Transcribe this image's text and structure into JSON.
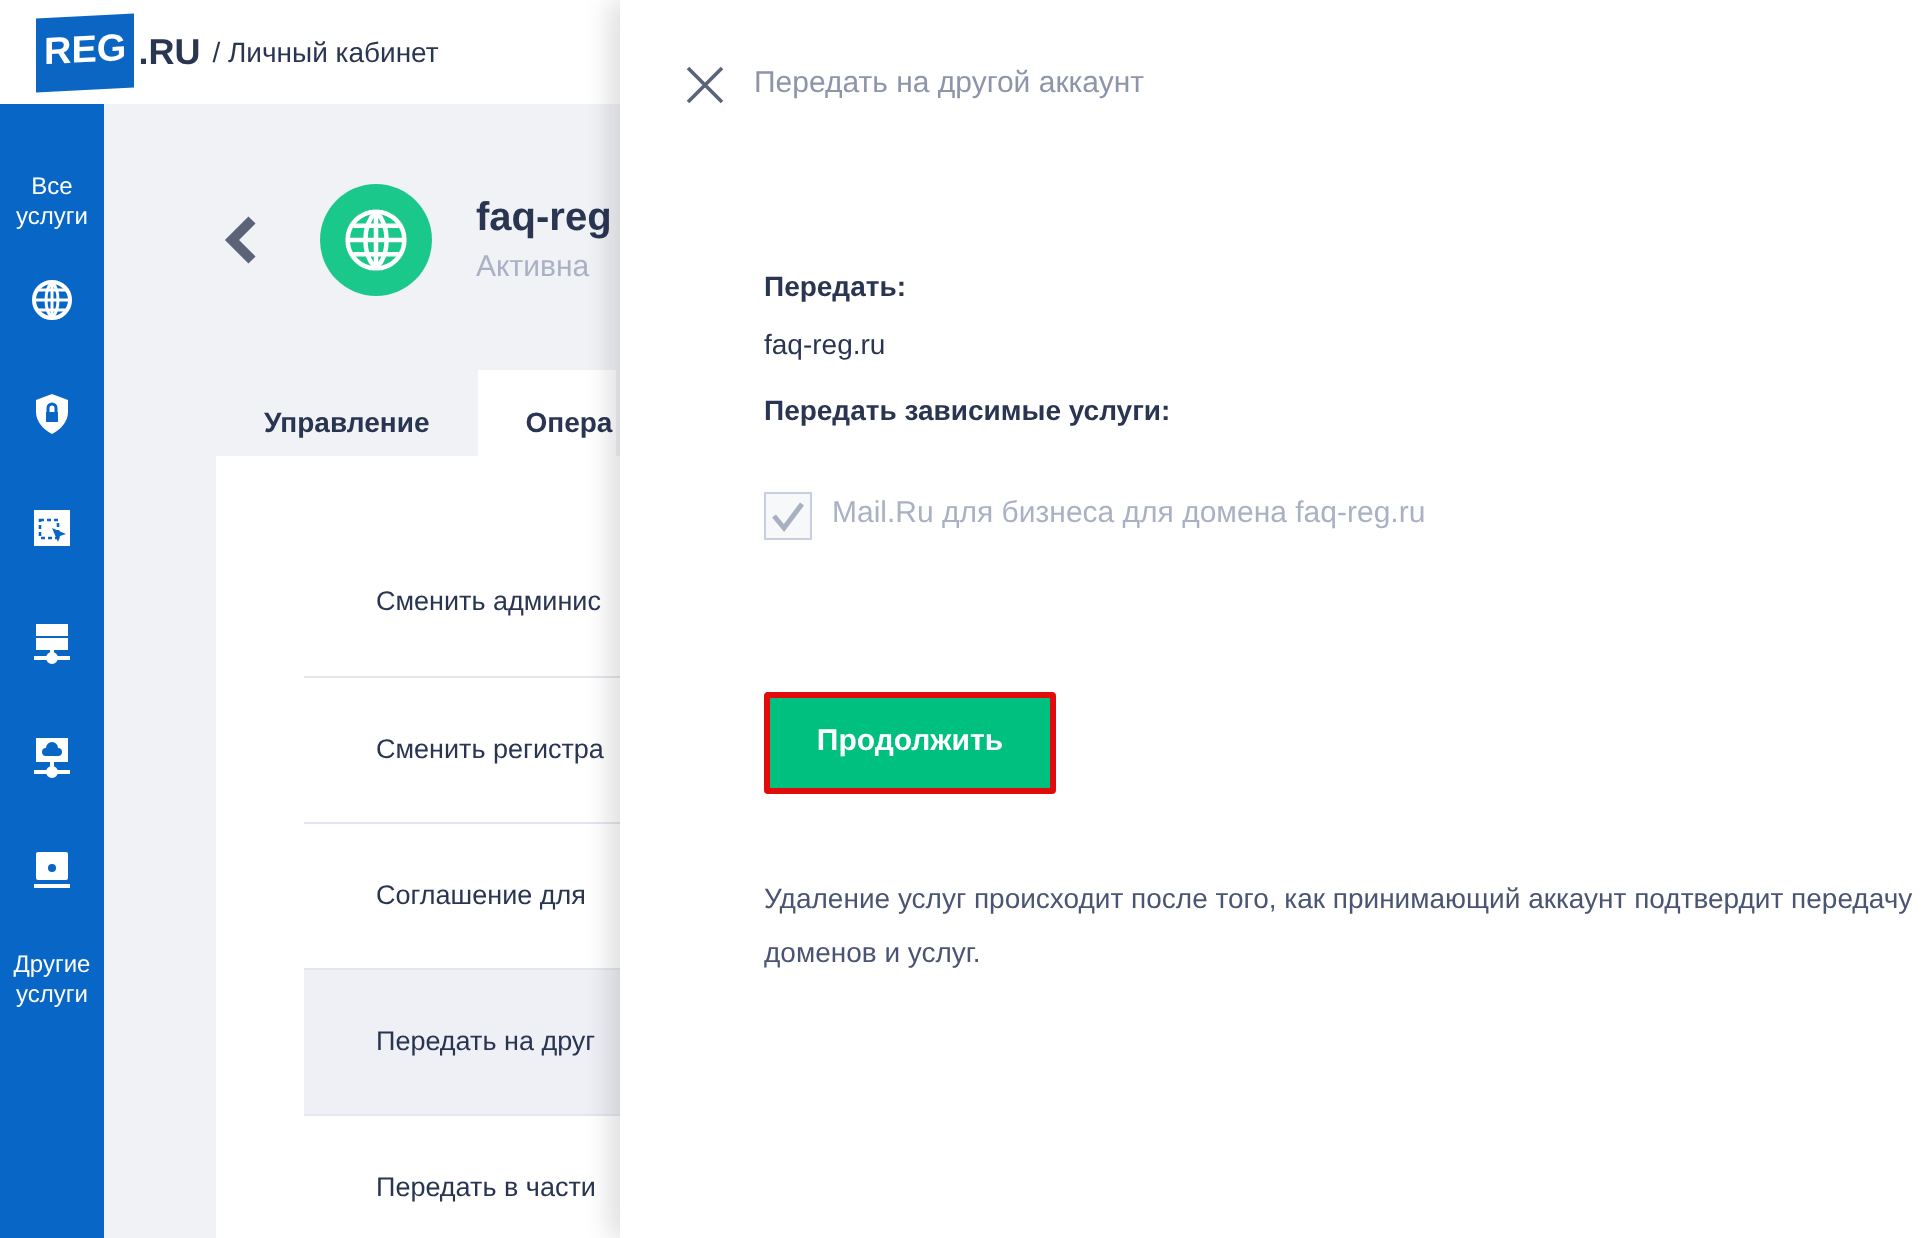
{
  "header": {
    "logo": "REG",
    "logo_suffix": ".RU",
    "breadcrumb": "/ Личный кабинет"
  },
  "sidebar": {
    "top_label": "Все услуги",
    "bottom_label": "Другие услуги"
  },
  "service": {
    "title": "faq-reg",
    "status": "Активна"
  },
  "tabs": [
    {
      "label": "Управление",
      "selected": false
    },
    {
      "label": "Опера",
      "selected": true
    }
  ],
  "operations": [
    {
      "label": "Сменить админис",
      "selected": false
    },
    {
      "label": "Сменить регистра",
      "selected": false
    },
    {
      "label": "Соглашение для",
      "selected": false
    },
    {
      "label": "Передать на друг",
      "selected": true
    },
    {
      "label": "Передать в части",
      "selected": false
    }
  ],
  "drawer": {
    "title": "Передать на другой аккаунт",
    "transfer_label": "Передать:",
    "transfer_value": "faq-reg.ru",
    "dependent_label": "Передать зависимые услуги:",
    "dependents": [
      {
        "label": "Mail.Ru для бизнеса для домена faq-reg.ru",
        "checked": true,
        "disabled": true
      }
    ],
    "continue_button": {
      "label": "Продолжить",
      "highlighted": true
    },
    "note": "Удаление услуг происходит после того, как принимающий аккаунт подтвердит передачу доменов и услуг."
  }
}
